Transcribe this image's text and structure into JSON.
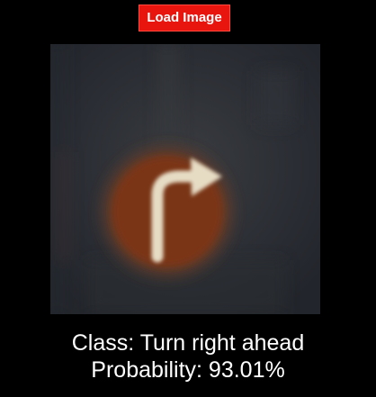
{
  "toolbar": {
    "load_button_label": "Load Image",
    "accent_color": "#e8150f"
  },
  "preview": {
    "image_subject": "turn-right-ahead traffic sign",
    "sign_colors": {
      "disc": "#7a3515",
      "arrow": "#e6dcc4",
      "background": "#2c2f35"
    }
  },
  "result": {
    "class_text": "Class: Turn right ahead",
    "probability_text": "Probability: 93.01%"
  }
}
